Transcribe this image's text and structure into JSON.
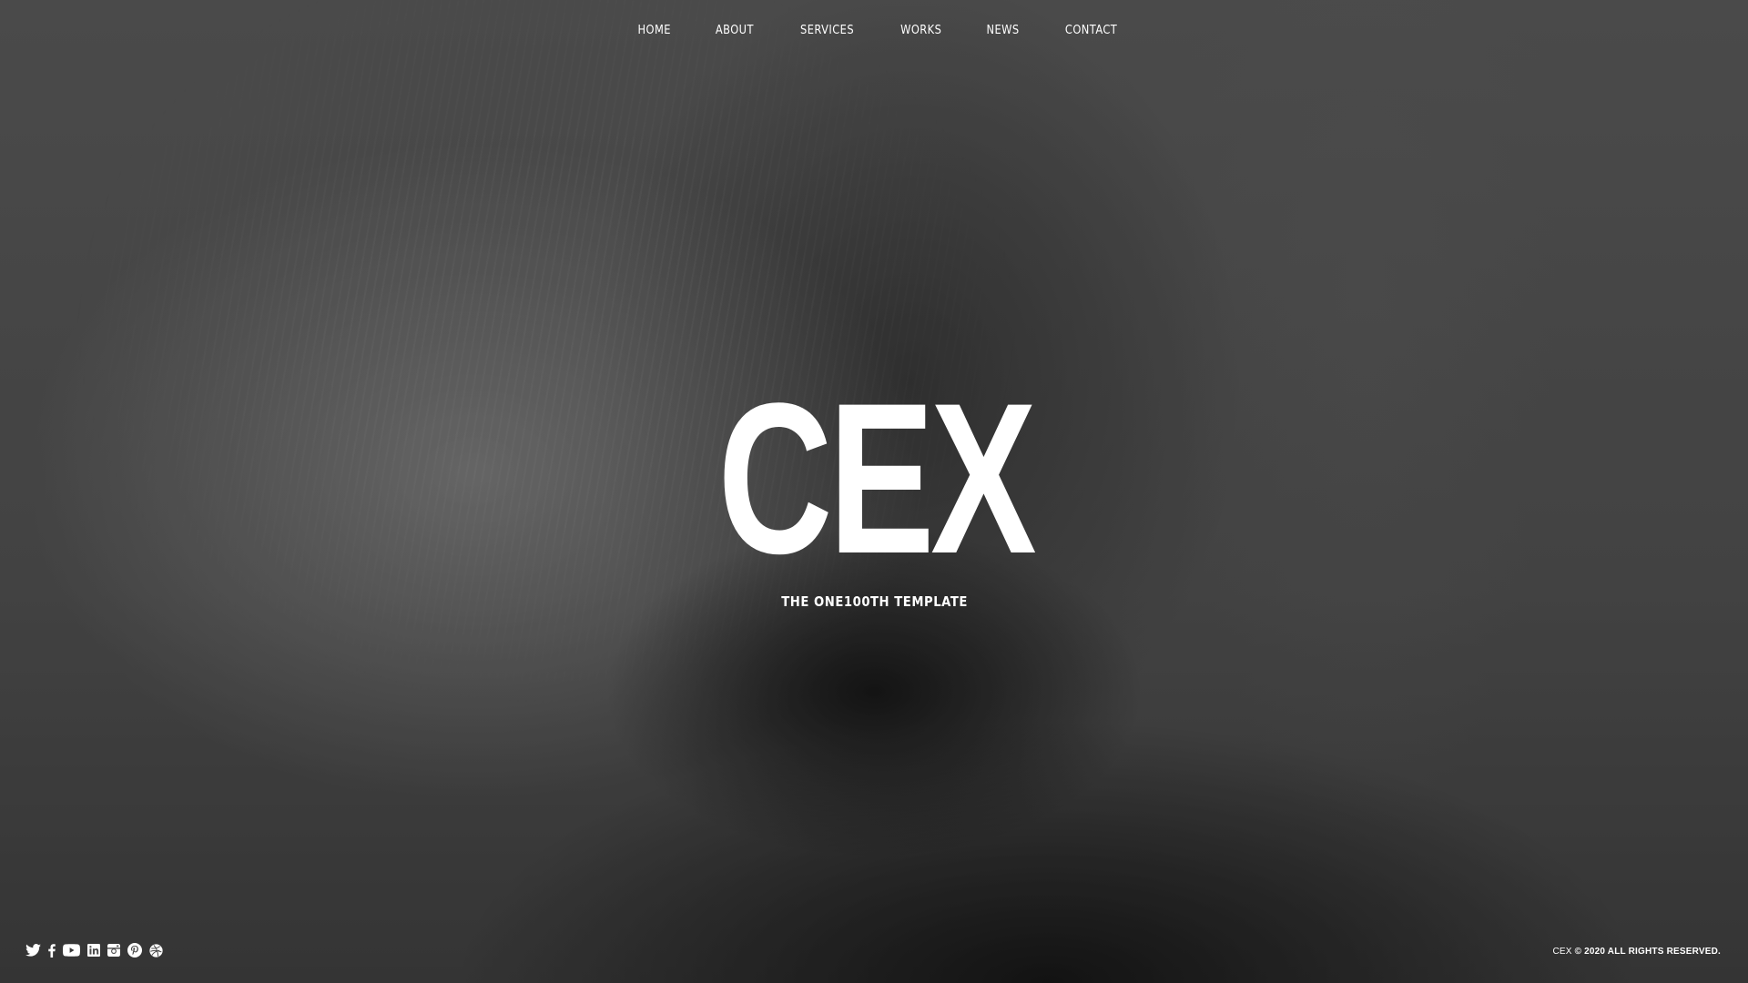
{
  "nav": {
    "items": [
      {
        "label": "HOME"
      },
      {
        "label": "ABOUT"
      },
      {
        "label": "SERVICES"
      },
      {
        "label": "WORKS"
      },
      {
        "label": "NEWS"
      },
      {
        "label": "CONTACT"
      }
    ]
  },
  "hero": {
    "title": "CEX",
    "subtitle": "THE ONE100TH TEMPLATE"
  },
  "social": {
    "icons": [
      "twitter-icon",
      "facebook-icon",
      "youtube-icon",
      "linkedin-icon",
      "instagram-icon",
      "pinterest-icon",
      "dribbble-icon"
    ]
  },
  "footer": {
    "brand": "CEX",
    "copyright": "© 2020 ALL RIGHTS RESERVED."
  },
  "colors": {
    "text": "#ffffff",
    "background": "#4e4e4e"
  }
}
